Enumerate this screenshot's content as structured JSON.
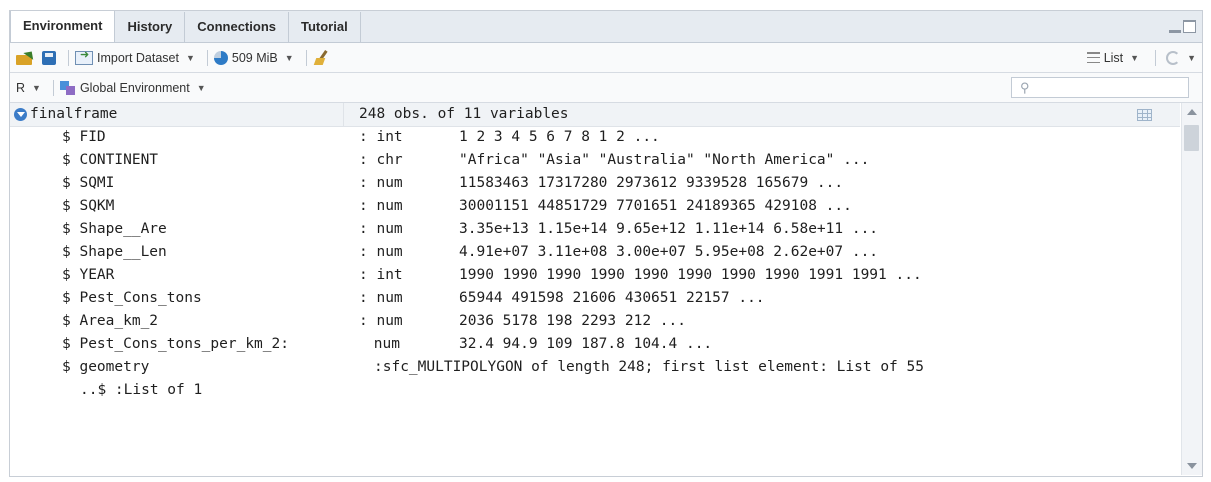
{
  "tabs": [
    {
      "label": "Environment",
      "active": true
    },
    {
      "label": "History",
      "active": false
    },
    {
      "label": "Connections",
      "active": false
    },
    {
      "label": "Tutorial",
      "active": false
    }
  ],
  "toolbar": {
    "import_label": "Import Dataset",
    "memory_label": "509 MiB",
    "view_mode_label": "List"
  },
  "env_bar": {
    "language_label": "R",
    "environment_label": "Global Environment",
    "search_placeholder": ""
  },
  "object": {
    "name": "finalframe",
    "summary": "248 obs. of 11 variables"
  },
  "variables": [
    {
      "name": "$ FID",
      "type": ": int",
      "value": "1 2 3 4 5 6 7 8 1 2 ..."
    },
    {
      "name": "$ CONTINENT",
      "type": ": chr",
      "value": "\"Africa\" \"Asia\" \"Australia\" \"North America\" ..."
    },
    {
      "name": "$ SQMI",
      "type": ": num",
      "value": "11583463 17317280 2973612 9339528 165679 ..."
    },
    {
      "name": "$ SQKM",
      "type": ": num",
      "value": "30001151 44851729 7701651 24189365 429108 ..."
    },
    {
      "name": "$ Shape__Are",
      "type": ": num",
      "value": "3.35e+13 1.15e+14 9.65e+12 1.11e+14 6.58e+11 ..."
    },
    {
      "name": "$ Shape__Len",
      "type": ": num",
      "value": "4.91e+07 3.11e+08 3.00e+07 5.95e+08 2.62e+07 ..."
    },
    {
      "name": "$ YEAR",
      "type": ": int",
      "value": "1990 1990 1990 1990 1990 1990 1990 1990 1991 1991 ..."
    },
    {
      "name": "$ Pest_Cons_tons",
      "type": ": num",
      "value": "65944 491598 21606 430651 22157 ..."
    },
    {
      "name": "$ Area_km_2",
      "type": ": num",
      "value": "2036 5178 198 2293 212 ..."
    },
    {
      "name": "$ Pest_Cons_tons_per_km_2:",
      "type": " num",
      "value": "32.4 94.9 109 187.8 104.4 ..."
    },
    {
      "name": "$ geometry",
      "type": ":sfc_MULTIPOLYGON of length 248; first list element: List of 55",
      "value": ""
    },
    {
      "name": "..$ :List of 1",
      "type": "",
      "value": ""
    }
  ]
}
